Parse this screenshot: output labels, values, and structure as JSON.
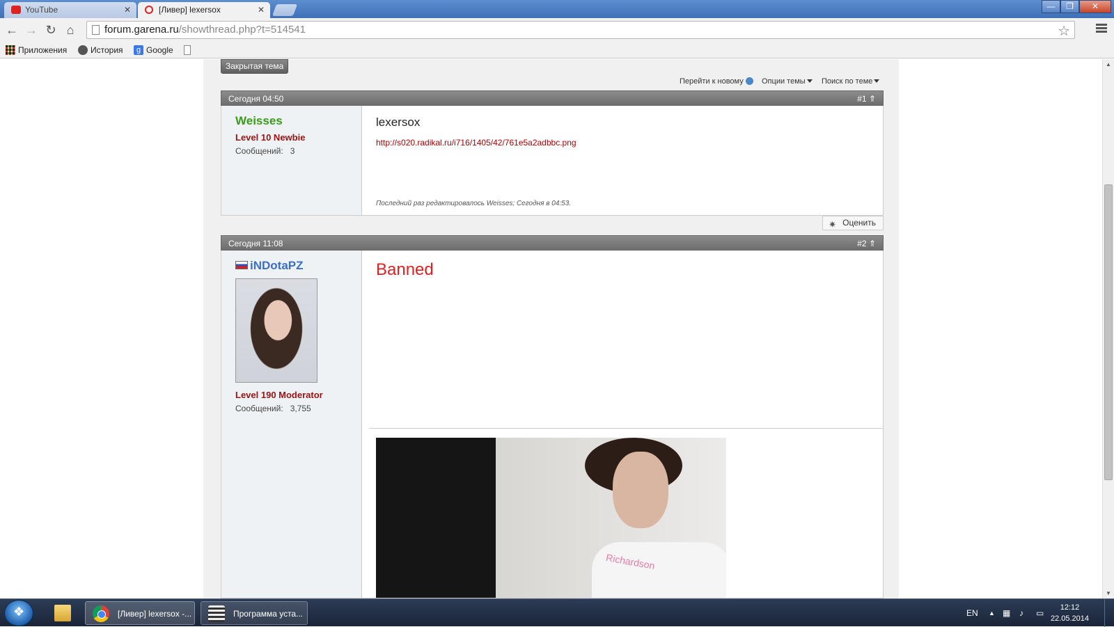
{
  "browser": {
    "tabs": [
      {
        "label": "YouTube",
        "active": false
      },
      {
        "label": "[Ливер] lexersox",
        "active": true
      }
    ],
    "url_host": "forum.garena.ru",
    "url_path": "/showthread.php?t=514541",
    "bookmarks": [
      {
        "label": "Приложения",
        "icon": "apps-grid-icon"
      },
      {
        "label": "История",
        "icon": "history-clock-icon"
      },
      {
        "label": "Google",
        "icon": "google-icon"
      }
    ],
    "window_controls": {
      "minimize": "—",
      "maximize": "❐",
      "close": "✕"
    }
  },
  "thread": {
    "closed_label": "Закрытая тема",
    "tools": {
      "go_new": "Перейти к новому",
      "options": "Опции темы",
      "search": "Поиск по теме"
    }
  },
  "posts": [
    {
      "date": "Сегодня 04:50",
      "number": "#1 ⇑",
      "username": "Weisses",
      "username_color": "#3a9a1a",
      "level": "Level 10 Newbie",
      "posts_label": "Сообщений:",
      "posts_count": "3",
      "title": "lexersox",
      "link": "http://s020.radikal.ru/i716/1405/42/761e5a2adbbc.png",
      "edited": "Последний раз редактировалось Weisses; Сегодня в 04:53.",
      "rate_label": "Оценить"
    },
    {
      "date": "Сегодня 11:08",
      "number": "#2 ⇑",
      "username": "iNDotaPZ",
      "username_color": "#3a6fc8",
      "level": "Level 190 Moderator",
      "posts_label": "Сообщений:",
      "posts_count": "3,755",
      "title": "Banned",
      "image_text": "Richardson"
    }
  ],
  "taskbar": {
    "apps": [
      {
        "label": "[Ливер] lexersox -..."
      },
      {
        "label": "Программа уста..."
      }
    ],
    "lang": "EN",
    "time": "12:12",
    "date": "22.05.2014"
  },
  "colors": {
    "accent_red": "#9a1212",
    "banned_red": "#e02020",
    "link_red": "#aa0000"
  }
}
